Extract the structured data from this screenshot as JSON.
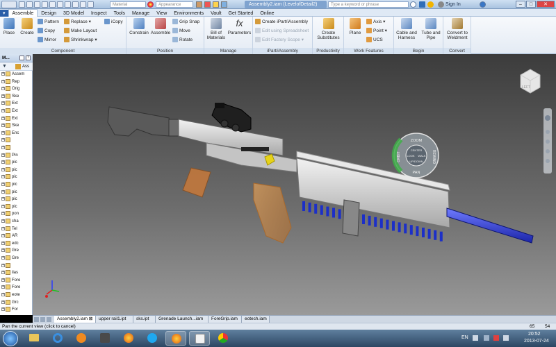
{
  "title_bar": {
    "material": "Material",
    "appearance": "Appearance",
    "document_title": "Assembly2.iam (LevelofDetail2)",
    "search_placeholder": "Type a keyword or phrase",
    "sign_in": "Sign In"
  },
  "tabs": [
    "Assemble",
    "Design",
    "3D Model",
    "Inspect",
    "Tools",
    "Manage",
    "View",
    "Environments",
    "Vault",
    "Get Started",
    "Online"
  ],
  "ribbon": {
    "component": {
      "title": "Component",
      "place": "Place",
      "create": "Create",
      "pattern": "Pattern",
      "copy": "Copy",
      "mirror": "Mirror",
      "replace": "Replace",
      "make_layout": "Make Layout",
      "shrinkwrap": "Shrinkwrap",
      "icopy": "iCopy"
    },
    "position": {
      "title": "Position",
      "constrain": "Constrain",
      "assemble": "Assemble",
      "grip_snap": "Grip Snap",
      "move": "Move",
      "rotate": "Rotate"
    },
    "manage": {
      "title": "Manage",
      "bom": "Bill of Materials",
      "parameters": "Parameters"
    },
    "ipart": {
      "title": "iPart/iAssembly",
      "create": "Create iPart/iAssembly",
      "edit_spreadsheet": "Edit using Spreadsheet",
      "edit_scope": "Edit Factory Scope"
    },
    "productivity": {
      "title": "Productivity",
      "create_substitutes": "Create Substitutes"
    },
    "work_features": {
      "title": "Work Features",
      "plane": "Plane",
      "axis": "Axis",
      "point": "Point",
      "ucs": "UCS"
    },
    "begin": {
      "title": "Begin",
      "cable_harness": "Cable and Harness",
      "tube_pipe": "Tube and Pipe"
    },
    "convert": {
      "title": "Convert",
      "convert_weldment": "Convert to Weldment"
    }
  },
  "browser": {
    "header": "M...",
    "toolbar_label": "Ass",
    "items": [
      "Assem",
      "Rep",
      "Orig",
      "Ske",
      "Ext",
      "Ext",
      "Ext",
      "Ske",
      "Enc",
      "",
      "",
      "Pin",
      "pic",
      "pic",
      "pic",
      "pic",
      "pic",
      "pic",
      "pic",
      "pon",
      "cha",
      "Tel",
      "AR",
      "edc",
      "Gre",
      "Gre",
      "",
      "ilas",
      "Fore",
      "Fore",
      "eote",
      "Grc",
      "For"
    ]
  },
  "viewcube": {
    "face": "LEFT"
  },
  "steering_wheel": {
    "top": "ZOOM",
    "left": "ORBIT",
    "right": "REWIND",
    "bottom": "PAN",
    "center_top": "CENTER",
    "center_right": "WALK",
    "center_bottom": "UP/DOWN",
    "center_left": "LOOK"
  },
  "doc_tabs": [
    "Assembly2.iam",
    "upper rail1.ipt",
    "sks.ipt",
    "Grenade Launch...iam",
    "ForeGrip.iam",
    "eotech.iam"
  ],
  "status": {
    "text": "Pan the current view (click to cancel)",
    "count1": "65",
    "count2": "54"
  },
  "taskbar": {
    "lang": "EN",
    "time": "20:52",
    "date": "2013-07-24"
  },
  "colors": {
    "rail_blue": "#1c2fc8",
    "barrel_blue": "#2f3fe0",
    "stock_gray": "#5a5a5a",
    "magazine_orange": "#d78a3a"
  }
}
